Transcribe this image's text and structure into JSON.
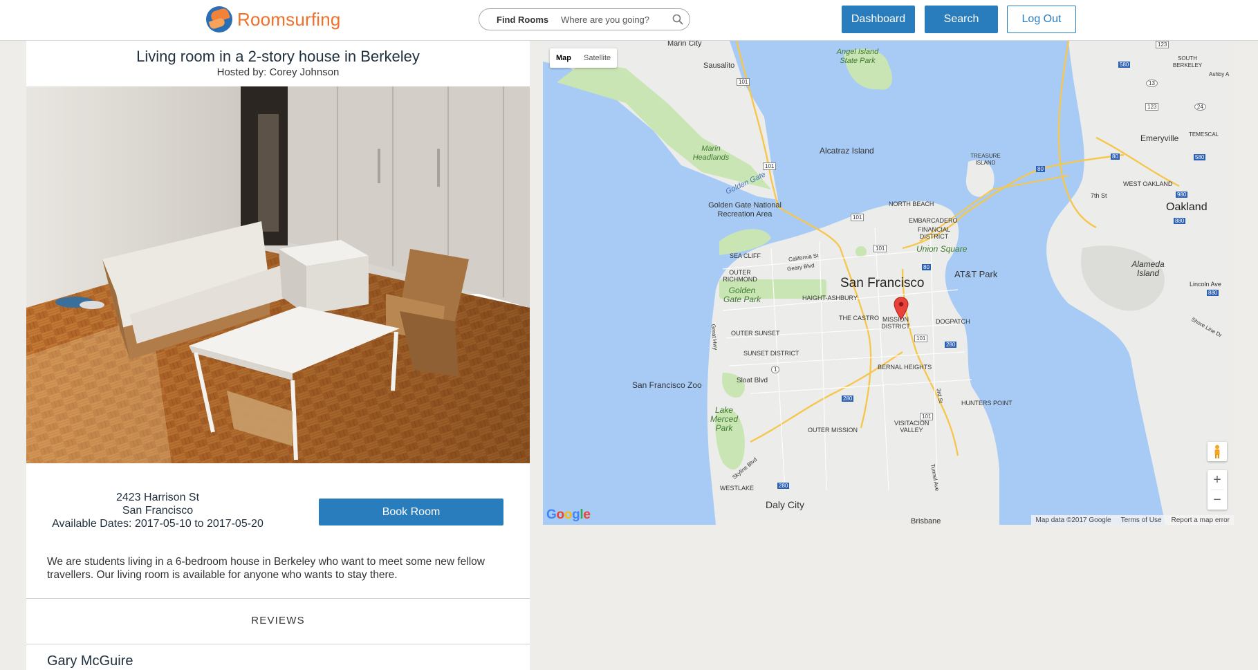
{
  "header": {
    "logo_text": "Roomsurfing",
    "search": {
      "find_label": "Find Rooms",
      "placeholder": "Where are you going?"
    },
    "buttons": {
      "dashboard": "Dashboard",
      "search": "Search",
      "logout": "Log Out"
    }
  },
  "listing": {
    "title": "Living room in a 2-story house in Berkeley",
    "hosted_by": "Hosted by: Corey Johnson",
    "street": "2423 Harrison St",
    "city": "San Francisco",
    "dates": "Available Dates: 2017-05-10 to 2017-05-20",
    "book_label": "Book Room",
    "description": "We are students living in a 6-bedroom house in Berkeley who want to meet some new fellow travellers. Our living room is available for anyone who wants to stay there.",
    "reviews_heading": "REVIEWS",
    "reviews": [
      {
        "author": "Gary McGuire"
      }
    ]
  },
  "map": {
    "type_map": "Map",
    "type_satellite": "Satellite",
    "google_logo": "Google",
    "attribution": [
      "Map data ©2017 Google",
      "Terms of Use",
      "Report a map error"
    ],
    "labels": {
      "marin_city": "Marin City",
      "sausalito": "Sausalito",
      "angel_island": "Angel Island State Park",
      "alcatraz": "Alcatraz Island",
      "marin_headlands": "Marin Headlands",
      "golden_gate": "Golden Gate",
      "gg_recreation": "Golden Gate National Recreation Area",
      "north_beach": "NORTH BEACH",
      "embarcadero": "EMBARCADERO",
      "financial": "FINANCIAL DISTRICT",
      "union_square": "Union Square",
      "treasure_island": "TREASURE ISLAND",
      "sea_cliff": "SEA CLIFF",
      "outer_richmond": "OUTER RICHMOND",
      "att_park": "AT&T Park",
      "san_francisco": "San Francisco",
      "ggpark": "Golden Gate Park",
      "haight": "HAIGHT-ASHBURY",
      "castro": "THE CASTRO",
      "mission": "MISSION DISTRICT",
      "dogpatch": "DOGPATCH",
      "outer_sunset": "OUTER SUNSET",
      "sunset_district": "SUNSET DISTRICT",
      "bernal": "BERNAL HEIGHTS",
      "sf_zoo": "San Francisco Zoo",
      "sloat": "Sloat Blvd",
      "hunters_point": "HUNTERS POINT",
      "lake_merced": "Lake Merced Park",
      "outer_mission": "OUTER MISSION",
      "visitacion": "VISITACION VALLEY",
      "westlake": "WESTLAKE",
      "daly_city": "Daly City",
      "brisbane": "Brisbane",
      "south_berkeley": "SOUTH BERKELEY",
      "emeryville": "Emeryville",
      "temescal": "TEMESCAL",
      "west_oakland": "WEST OAKLAND",
      "oakland": "Oakland",
      "alameda": "Alameda Island",
      "lincoln_ave": "Lincoln Ave",
      "seventh_st": "7th St",
      "california_st": "California St",
      "geary_blvd": "Geary Blvd",
      "great_hwy": "Great Hwy",
      "third_st": "3rd St",
      "tunnel_ave": "Tunnel Ave",
      "skyline_blvd": "Skyline Blvd",
      "shore_line": "Shore Line Dr",
      "ashby": "Ashby A"
    },
    "shields": [
      "101",
      "101",
      "101",
      "101",
      "101",
      "101",
      "80",
      "80",
      "80",
      "580",
      "580",
      "880",
      "880",
      "980",
      "280",
      "280",
      "280",
      "24",
      "123",
      "123",
      "13",
      "1"
    ]
  },
  "colors": {
    "accent": "#2a7dbd",
    "logo_orange": "#ef6f2b",
    "water": "#a8cbf5",
    "land": "#ececea",
    "park": "#c9e5b4",
    "marker": "#e8423b"
  }
}
